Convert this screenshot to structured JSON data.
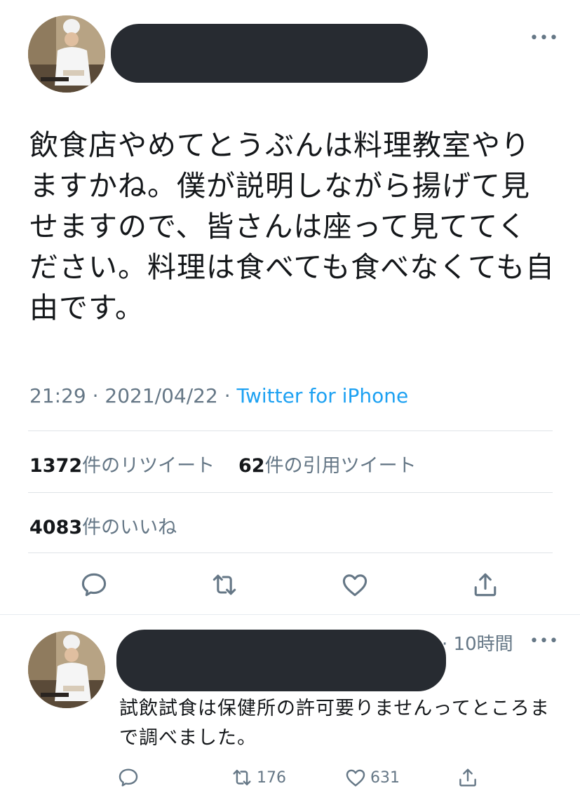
{
  "main_tweet": {
    "text": "飲食店やめてとうぶんは料理教室やりますかね。僕が説明しながら揚げて見せますので、皆さんは座って見ててください。料理は食べても食べなくても自由です。",
    "time": "21:29",
    "date": "2021/04/22",
    "source": "Twitter for iPhone",
    "retweet_count": "1372",
    "retweet_label": "件のリツイート",
    "quote_count": "62",
    "quote_label": "件の引用ツイート",
    "like_count": "4083",
    "like_label": "件のいいね"
  },
  "reply": {
    "time_ago": "· 10時間",
    "text": "試飲試食は保健所の許可要りませんってところまで調べました。",
    "retweet_count": "176",
    "like_count": "631"
  },
  "icons": {
    "more": "more-dots-icon",
    "reply": "comment-icon",
    "retweet": "retweet-icon",
    "like": "heart-icon",
    "share": "share-icon"
  },
  "colors": {
    "accent": "#1da1f2",
    "muted": "#657786",
    "text": "#14171a",
    "redaction": "#272b31"
  }
}
